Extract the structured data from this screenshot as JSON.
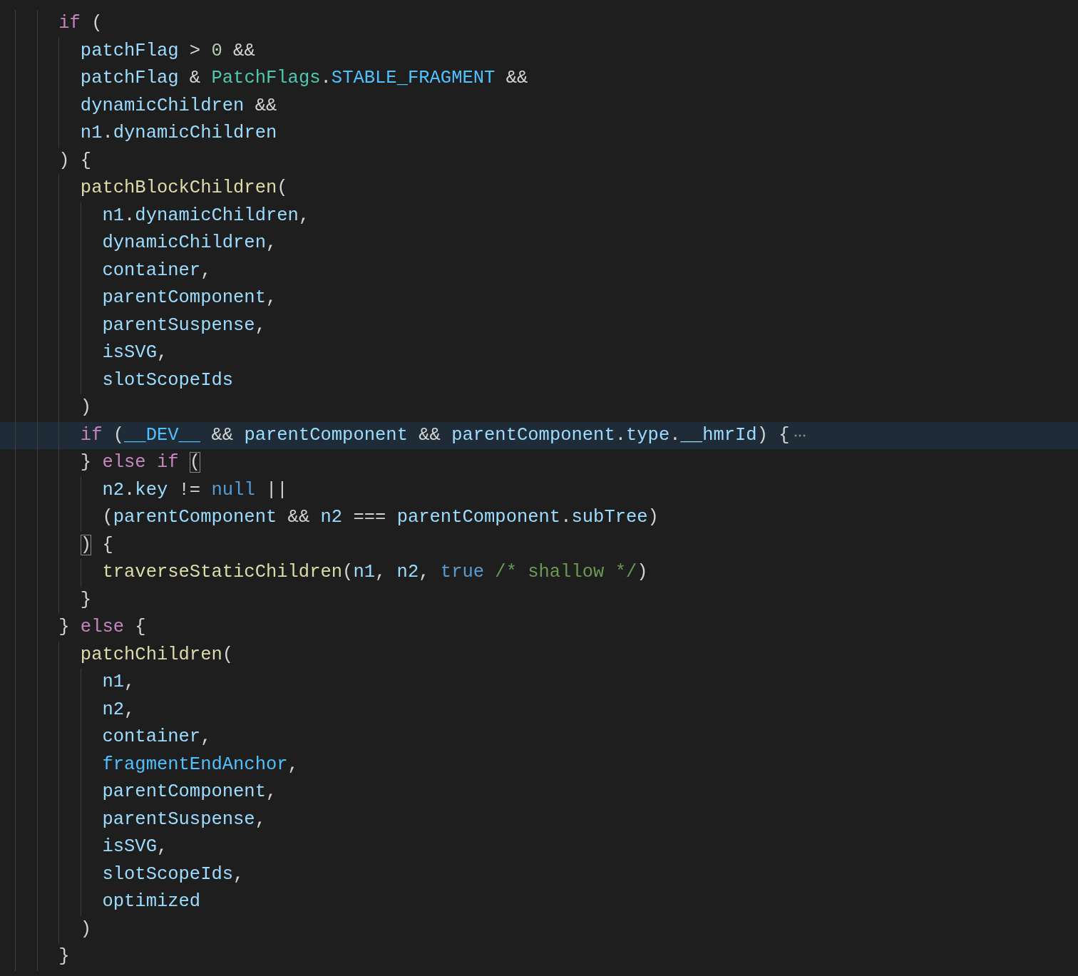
{
  "lines": [
    {
      "highlighted": false,
      "folded": false,
      "tokens": [
        {
          "text": "    if",
          "kind": "keyword"
        },
        {
          "text": " (",
          "kind": "punct"
        }
      ]
    },
    {
      "highlighted": false,
      "folded": false,
      "tokens": [
        {
          "text": "      patchFlag",
          "kind": "variable"
        },
        {
          "text": " > ",
          "kind": "punct"
        },
        {
          "text": "0",
          "kind": "number"
        },
        {
          "text": " &&",
          "kind": "punct"
        }
      ]
    },
    {
      "highlighted": false,
      "folded": false,
      "tokens": [
        {
          "text": "      patchFlag",
          "kind": "variable"
        },
        {
          "text": " & ",
          "kind": "punct"
        },
        {
          "text": "PatchFlags",
          "kind": "type"
        },
        {
          "text": ".",
          "kind": "punct"
        },
        {
          "text": "STABLE_FRAGMENT",
          "kind": "constant"
        },
        {
          "text": " &&",
          "kind": "punct"
        }
      ]
    },
    {
      "highlighted": false,
      "folded": false,
      "tokens": [
        {
          "text": "      dynamicChildren",
          "kind": "variable"
        },
        {
          "text": " &&",
          "kind": "punct"
        }
      ]
    },
    {
      "highlighted": false,
      "folded": false,
      "tokens": [
        {
          "text": "      n1",
          "kind": "variable"
        },
        {
          "text": ".",
          "kind": "punct"
        },
        {
          "text": "dynamicChildren",
          "kind": "variable"
        }
      ]
    },
    {
      "highlighted": false,
      "folded": false,
      "tokens": [
        {
          "text": "    ) {",
          "kind": "punct"
        }
      ]
    },
    {
      "highlighted": false,
      "folded": false,
      "tokens": [
        {
          "text": "      patchBlockChildren",
          "kind": "function"
        },
        {
          "text": "(",
          "kind": "punct"
        }
      ]
    },
    {
      "highlighted": false,
      "folded": false,
      "tokens": [
        {
          "text": "        n1",
          "kind": "variable"
        },
        {
          "text": ".",
          "kind": "punct"
        },
        {
          "text": "dynamicChildren",
          "kind": "variable"
        },
        {
          "text": ",",
          "kind": "punct"
        }
      ]
    },
    {
      "highlighted": false,
      "folded": false,
      "tokens": [
        {
          "text": "        dynamicChildren",
          "kind": "variable"
        },
        {
          "text": ",",
          "kind": "punct"
        }
      ]
    },
    {
      "highlighted": false,
      "folded": false,
      "tokens": [
        {
          "text": "        container",
          "kind": "variable"
        },
        {
          "text": ",",
          "kind": "punct"
        }
      ]
    },
    {
      "highlighted": false,
      "folded": false,
      "tokens": [
        {
          "text": "        parentComponent",
          "kind": "variable"
        },
        {
          "text": ",",
          "kind": "punct"
        }
      ]
    },
    {
      "highlighted": false,
      "folded": false,
      "tokens": [
        {
          "text": "        parentSuspense",
          "kind": "variable"
        },
        {
          "text": ",",
          "kind": "punct"
        }
      ]
    },
    {
      "highlighted": false,
      "folded": false,
      "tokens": [
        {
          "text": "        isSVG",
          "kind": "variable"
        },
        {
          "text": ",",
          "kind": "punct"
        }
      ]
    },
    {
      "highlighted": false,
      "folded": false,
      "tokens": [
        {
          "text": "        slotScopeIds",
          "kind": "variable"
        }
      ]
    },
    {
      "highlighted": false,
      "folded": false,
      "tokens": [
        {
          "text": "      )",
          "kind": "punct"
        }
      ]
    },
    {
      "highlighted": true,
      "folded": true,
      "tokens": [
        {
          "text": "      if",
          "kind": "keyword"
        },
        {
          "text": " (",
          "kind": "punct"
        },
        {
          "text": "__DEV__",
          "kind": "constant"
        },
        {
          "text": " && ",
          "kind": "punct"
        },
        {
          "text": "parentComponent",
          "kind": "variable"
        },
        {
          "text": " && ",
          "kind": "punct"
        },
        {
          "text": "parentComponent",
          "kind": "variable"
        },
        {
          "text": ".",
          "kind": "punct"
        },
        {
          "text": "type",
          "kind": "variable"
        },
        {
          "text": ".",
          "kind": "punct"
        },
        {
          "text": "__hmrId",
          "kind": "variable"
        },
        {
          "text": ") {",
          "kind": "punct"
        }
      ]
    },
    {
      "highlighted": false,
      "folded": false,
      "tokens": [
        {
          "text": "      } ",
          "kind": "punct"
        },
        {
          "text": "else if ",
          "kind": "keyword"
        },
        {
          "text": "(",
          "kind": "bracket-match"
        }
      ]
    },
    {
      "highlighted": false,
      "folded": false,
      "tokens": [
        {
          "text": "        n2",
          "kind": "variable"
        },
        {
          "text": ".",
          "kind": "punct"
        },
        {
          "text": "key",
          "kind": "variable"
        },
        {
          "text": " != ",
          "kind": "punct"
        },
        {
          "text": "null",
          "kind": "literal"
        },
        {
          "text": " ||",
          "kind": "punct"
        }
      ]
    },
    {
      "highlighted": false,
      "folded": false,
      "tokens": [
        {
          "text": "        (",
          "kind": "punct"
        },
        {
          "text": "parentComponent",
          "kind": "variable"
        },
        {
          "text": " && ",
          "kind": "punct"
        },
        {
          "text": "n2",
          "kind": "variable"
        },
        {
          "text": " === ",
          "kind": "punct"
        },
        {
          "text": "parentComponent",
          "kind": "variable"
        },
        {
          "text": ".",
          "kind": "punct"
        },
        {
          "text": "subTree",
          "kind": "variable"
        },
        {
          "text": ")",
          "kind": "punct"
        }
      ]
    },
    {
      "highlighted": false,
      "folded": false,
      "tokens": [
        {
          "text": "      )",
          "kind": "bracket-match"
        },
        {
          "text": " {",
          "kind": "punct"
        }
      ]
    },
    {
      "highlighted": false,
      "folded": false,
      "tokens": [
        {
          "text": "        traverseStaticChildren",
          "kind": "function"
        },
        {
          "text": "(",
          "kind": "punct"
        },
        {
          "text": "n1",
          "kind": "variable"
        },
        {
          "text": ", ",
          "kind": "punct"
        },
        {
          "text": "n2",
          "kind": "variable"
        },
        {
          "text": ", ",
          "kind": "punct"
        },
        {
          "text": "true ",
          "kind": "literal"
        },
        {
          "text": "/* shallow */",
          "kind": "comment"
        },
        {
          "text": ")",
          "kind": "punct"
        }
      ]
    },
    {
      "highlighted": false,
      "folded": false,
      "tokens": [
        {
          "text": "      }",
          "kind": "punct"
        }
      ]
    },
    {
      "highlighted": false,
      "folded": false,
      "tokens": [
        {
          "text": "    } ",
          "kind": "punct"
        },
        {
          "text": "else",
          "kind": "keyword"
        },
        {
          "text": " {",
          "kind": "punct"
        }
      ]
    },
    {
      "highlighted": false,
      "folded": false,
      "tokens": [
        {
          "text": "      patchChildren",
          "kind": "function"
        },
        {
          "text": "(",
          "kind": "punct"
        }
      ]
    },
    {
      "highlighted": false,
      "folded": false,
      "tokens": [
        {
          "text": "        n1",
          "kind": "variable"
        },
        {
          "text": ",",
          "kind": "punct"
        }
      ]
    },
    {
      "highlighted": false,
      "folded": false,
      "tokens": [
        {
          "text": "        n2",
          "kind": "variable"
        },
        {
          "text": ",",
          "kind": "punct"
        }
      ]
    },
    {
      "highlighted": false,
      "folded": false,
      "tokens": [
        {
          "text": "        container",
          "kind": "variable"
        },
        {
          "text": ",",
          "kind": "punct"
        }
      ]
    },
    {
      "highlighted": false,
      "folded": false,
      "tokens": [
        {
          "text": "        fragmentEndAnchor",
          "kind": "constant"
        },
        {
          "text": ",",
          "kind": "punct"
        }
      ]
    },
    {
      "highlighted": false,
      "folded": false,
      "tokens": [
        {
          "text": "        parentComponent",
          "kind": "variable"
        },
        {
          "text": ",",
          "kind": "punct"
        }
      ]
    },
    {
      "highlighted": false,
      "folded": false,
      "tokens": [
        {
          "text": "        parentSuspense",
          "kind": "variable"
        },
        {
          "text": ",",
          "kind": "punct"
        }
      ]
    },
    {
      "highlighted": false,
      "folded": false,
      "tokens": [
        {
          "text": "        isSVG",
          "kind": "variable"
        },
        {
          "text": ",",
          "kind": "punct"
        }
      ]
    },
    {
      "highlighted": false,
      "folded": false,
      "tokens": [
        {
          "text": "        slotScopeIds",
          "kind": "variable"
        },
        {
          "text": ",",
          "kind": "punct"
        }
      ]
    },
    {
      "highlighted": false,
      "folded": false,
      "tokens": [
        {
          "text": "        optimized",
          "kind": "variable"
        }
      ]
    },
    {
      "highlighted": false,
      "folded": false,
      "tokens": [
        {
          "text": "      )",
          "kind": "punct"
        }
      ]
    },
    {
      "highlighted": false,
      "folded": false,
      "tokens": [
        {
          "text": "    }",
          "kind": "punct"
        }
      ]
    }
  ]
}
